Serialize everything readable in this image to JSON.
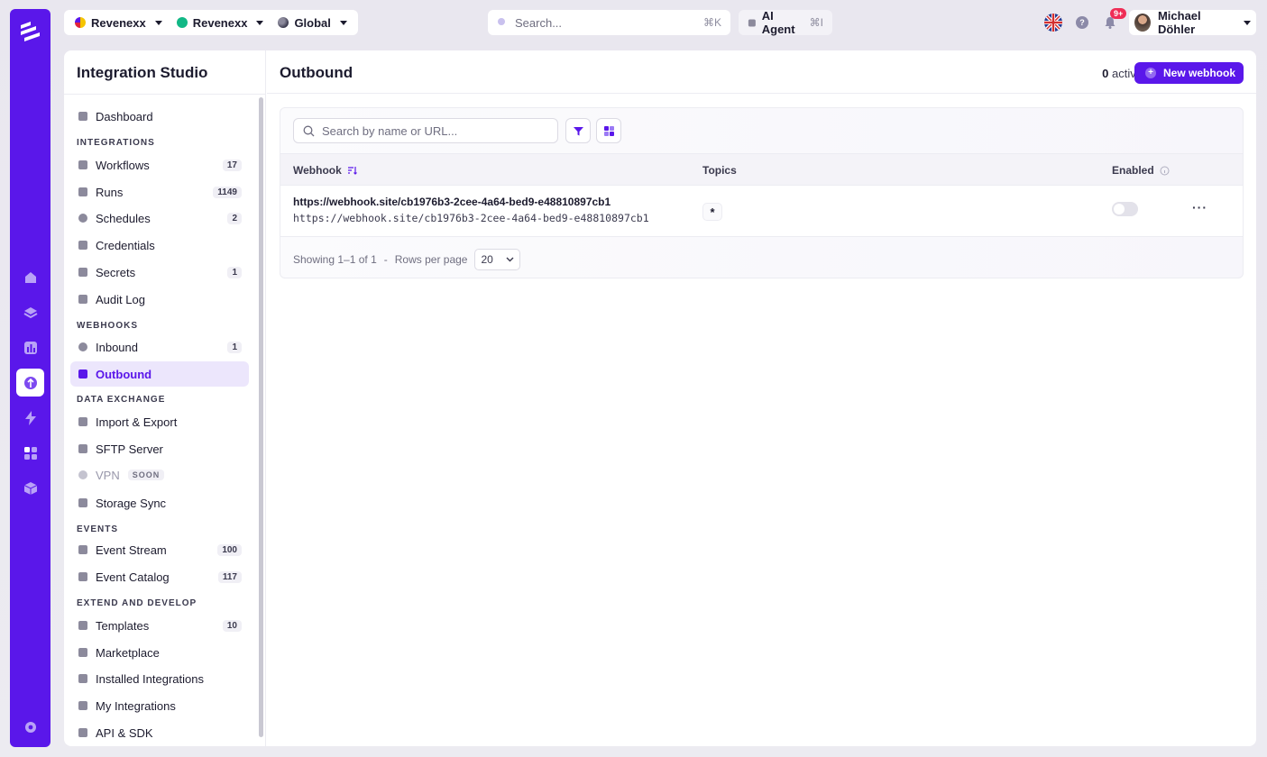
{
  "topbar": {
    "org": "Revenexx",
    "project": "Revenexx",
    "scope": "Global",
    "search_placeholder": "Search...",
    "search_shortcut": "⌘K",
    "agent_label": "AI Agent",
    "agent_shortcut": "⌘I",
    "help_label": "?",
    "notifications_badge": "9+",
    "user_name": "Michael Döhler"
  },
  "sidebar": {
    "title": "Integration Studio",
    "dashboard": "Dashboard",
    "sections": {
      "integrations": "INTEGRATIONS",
      "webhooks": "WEBHOOKS",
      "data_exchange": "DATA EXCHANGE",
      "events": "EVENTS",
      "extend": "EXTEND AND DEVELOP"
    },
    "items": {
      "workflows": {
        "label": "Workflows",
        "count": "17"
      },
      "runs": {
        "label": "Runs",
        "count": "1149"
      },
      "schedules": {
        "label": "Schedules",
        "count": "2"
      },
      "credentials": {
        "label": "Credentials"
      },
      "secrets": {
        "label": "Secrets",
        "count": "1"
      },
      "audit_log": {
        "label": "Audit Log"
      },
      "inbound": {
        "label": "Inbound",
        "count": "1"
      },
      "outbound": {
        "label": "Outbound"
      },
      "import_export": {
        "label": "Import & Export"
      },
      "sftp": {
        "label": "SFTP Server"
      },
      "vpn": {
        "label": "VPN",
        "tag": "SOON"
      },
      "storage_sync": {
        "label": "Storage Sync"
      },
      "event_stream": {
        "label": "Event Stream",
        "count": "100"
      },
      "event_catalog": {
        "label": "Event Catalog",
        "count": "117"
      },
      "templates": {
        "label": "Templates",
        "count": "10"
      },
      "marketplace": {
        "label": "Marketplace"
      },
      "installed": {
        "label": "Installed Integrations"
      },
      "my_integrations": {
        "label": "My Integrations"
      },
      "api_sdk": {
        "label": "API & SDK"
      }
    }
  },
  "main": {
    "title": "Outbound",
    "active_count": "0",
    "active_label": "active",
    "new_button": "New webhook",
    "plus_label": "+",
    "search_placeholder": "Search by name or URL...",
    "columns": {
      "webhook": "Webhook",
      "topics": "Topics",
      "enabled": "Enabled"
    },
    "row": {
      "name": "https://webhook.site/cb1976b3-2cee-4a64-bed9-e48810897cb1",
      "url": "https://webhook.site/cb1976b3-2cee-4a64-bed9-e48810897cb1",
      "topic": "*",
      "enabled": false,
      "more_label": "···"
    },
    "footer": {
      "showing": "Showing 1–1 of 1",
      "separator": "-",
      "rows_label": "Rows per page",
      "rows_value": "20"
    }
  },
  "colors": {
    "accent": "#5a17ea",
    "badge": "#ef2d56"
  }
}
